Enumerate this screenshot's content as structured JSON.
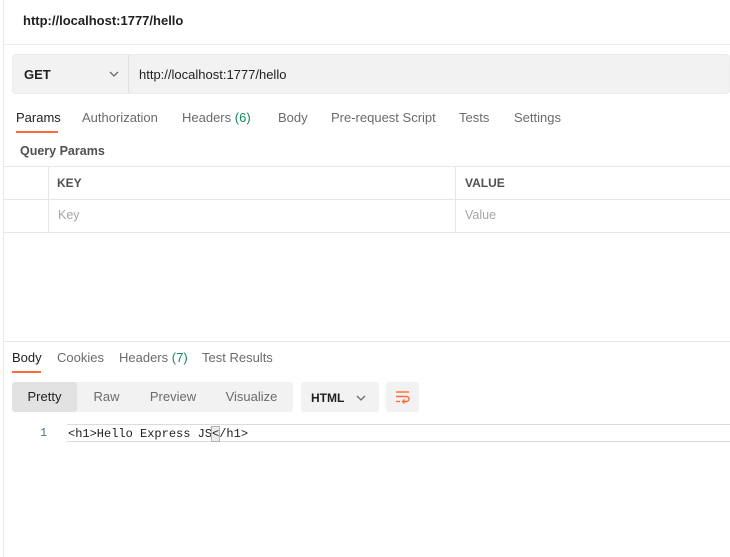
{
  "request": {
    "title": "http://localhost:1777/hello",
    "method": "GET",
    "url": "http://localhost:1777/hello"
  },
  "request_tabs": {
    "params": "Params",
    "authorization": "Authorization",
    "headers": "Headers",
    "headers_count": "(6)",
    "body": "Body",
    "pre_request_script": "Pre-request Script",
    "tests": "Tests",
    "settings": "Settings"
  },
  "query_params": {
    "label": "Query Params",
    "key_header": "KEY",
    "value_header": "VALUE",
    "key_placeholder": "Key",
    "value_placeholder": "Value"
  },
  "response_tabs": {
    "body": "Body",
    "cookies": "Cookies",
    "headers": "Headers",
    "headers_count": "(7)",
    "test_results": "Test Results"
  },
  "view_modes": {
    "pretty": "Pretty",
    "raw": "Raw",
    "preview": "Preview",
    "visualize": "Visualize",
    "selected": "Pretty"
  },
  "format": {
    "label": "HTML"
  },
  "response_body": {
    "line_number": "1",
    "code_before": "<h1>Hello Express JS",
    "code_bracket": "<",
    "code_after": "/h1>"
  },
  "colors": {
    "accent": "#ff6c37",
    "count_green": "#0f8b5a"
  },
  "icons": {
    "method_dropdown": "chevron-down-icon",
    "format_dropdown": "chevron-down-icon",
    "wrap": "wrap-lines-icon"
  }
}
